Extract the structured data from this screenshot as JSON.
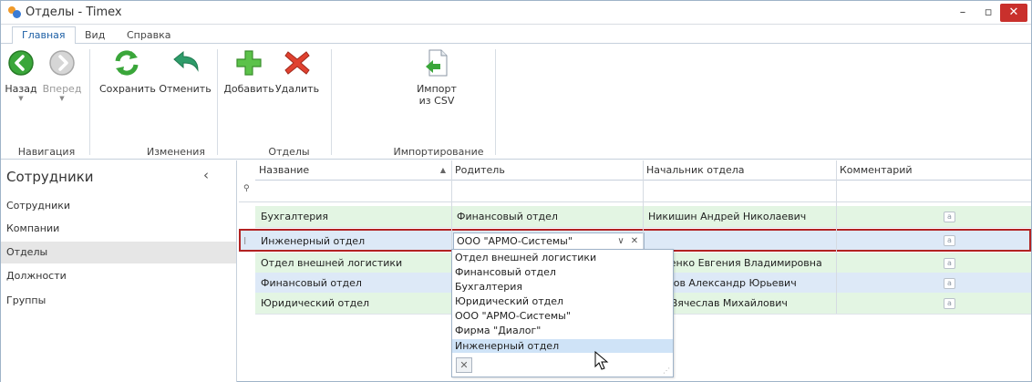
{
  "window": {
    "title": "Отделы - Timex",
    "min_glyph": "–",
    "max_glyph": "▫",
    "close_glyph": "✕"
  },
  "ribbon_tabs": [
    {
      "label": "Главная",
      "active": true
    },
    {
      "label": "Вид",
      "active": false
    },
    {
      "label": "Справка",
      "active": false
    }
  ],
  "ribbon": {
    "back": "Назад",
    "forward": "Вперед",
    "save": "Сохранить",
    "undo": "Отменить",
    "add": "Добавить",
    "delete": "Удалить",
    "import_line1": "Импорт",
    "import_line2": "из CSV",
    "groups": {
      "nav": "Навигация",
      "changes": "Изменения",
      "departments": "Отделы",
      "import": "Импортирование"
    }
  },
  "nav": {
    "header": "Сотрудники",
    "collapse_glyph": "‹",
    "items": [
      "Сотрудники",
      "Компании",
      "Отделы",
      "Должности",
      "Группы"
    ],
    "selected": "Отделы"
  },
  "grid": {
    "columns": [
      "Название",
      "Родитель",
      "Начальник отдела",
      "Комментарий"
    ],
    "sort_glyph": "▲",
    "filter_glyph": "⚲",
    "memo_glyph": "a",
    "rows": [
      {
        "name": "Бухгалтерия",
        "parent": "Финансовый отдел",
        "head": "Никишин Андрей Николаевич",
        "color": "#e3f5e3"
      },
      {
        "name": "Инженерный отдел",
        "parent": "ООО \"АРМО-Системы\"",
        "head": "",
        "color": "#dde9f7"
      },
      {
        "name": "Отдел внешней логистики",
        "parent": "",
        "head": "асенко Евгения Владимировна",
        "color": "#e3f5e3"
      },
      {
        "name": "Финансовый отдел",
        "parent": "",
        "head": "аров Александр Юрьевич",
        "color": "#dde9f7"
      },
      {
        "name": "Юридический отдел",
        "parent": "",
        "head": "н Вячеслав Михайлович",
        "color": "#e3f5e3"
      }
    ],
    "editor_value": "ООО \"АРМО-Системы\"",
    "editor_dd_glyph": "∨",
    "editor_clear_glyph": "✕"
  },
  "dropdown": {
    "options": [
      "Отдел внешней логистики",
      "Финансовый отдел",
      "Бухгалтерия",
      "Юридический отдел",
      "ООО \"АРМО-Системы\"",
      "Фирма \"Диалог\"",
      "Инженерный отдел"
    ],
    "highlighted": "Инженерный отдел",
    "clear_glyph": "✕",
    "grip_glyph": "⋰"
  },
  "colors": {
    "accent": "#1d5fa5",
    "row_green": "#e3f5e3",
    "row_blue": "#dde9f7",
    "edit_outline": "#b22222",
    "close_red": "#c9302c"
  }
}
